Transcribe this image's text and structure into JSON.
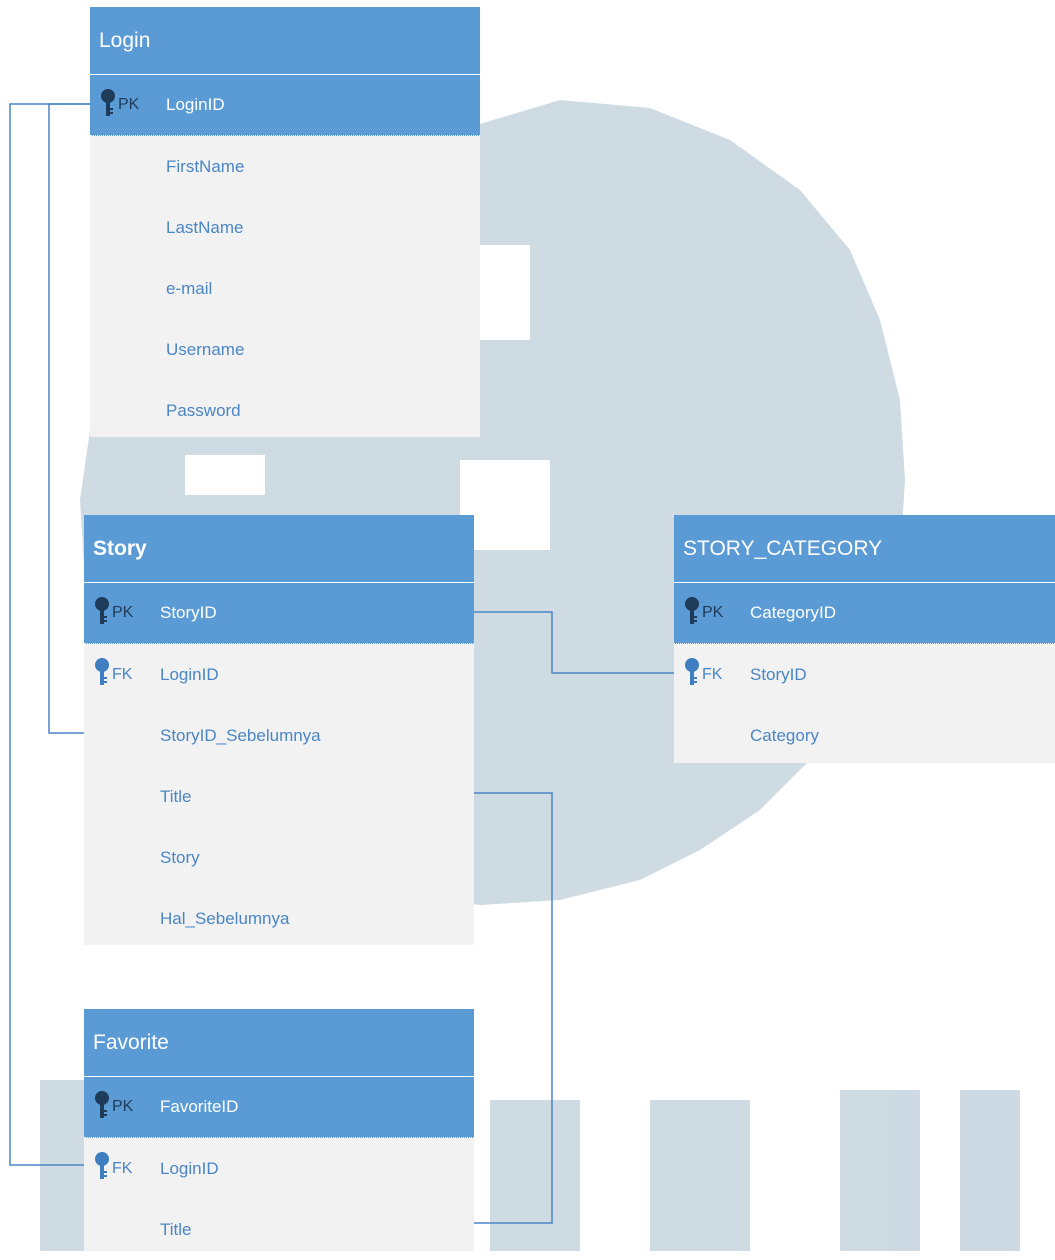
{
  "colors": {
    "header_bg": "#5b9bd5",
    "row_bg": "#f2f2f2",
    "field_text": "#4a86c5",
    "connector": "#4a86c5",
    "watermark": "#c9d7e0"
  },
  "icons": {
    "key": "key-icon"
  },
  "entities": {
    "login": {
      "title": "Login",
      "fields": [
        {
          "key": "PK",
          "name": "LoginID"
        },
        {
          "key": "",
          "name": "FirstName"
        },
        {
          "key": "",
          "name": "LastName"
        },
        {
          "key": "",
          "name": "e-mail"
        },
        {
          "key": "",
          "name": "Username"
        },
        {
          "key": "",
          "name": "Password"
        }
      ]
    },
    "story": {
      "title": "Story",
      "fields": [
        {
          "key": "PK",
          "name": "StoryID"
        },
        {
          "key": "FK",
          "name": "LoginID"
        },
        {
          "key": "",
          "name": "StoryID_Sebelumnya"
        },
        {
          "key": "",
          "name": "Title"
        },
        {
          "key": "",
          "name": "Story"
        },
        {
          "key": "",
          "name": "Hal_Sebelumnya"
        }
      ]
    },
    "story_category": {
      "title": "STORY_CATEGORY",
      "fields": [
        {
          "key": "PK",
          "name": "CategoryID"
        },
        {
          "key": "FK",
          "name": "StoryID"
        },
        {
          "key": "",
          "name": "Category"
        }
      ]
    },
    "favorite": {
      "title": "Favorite",
      "fields": [
        {
          "key": "PK",
          "name": "FavoriteID"
        },
        {
          "key": "FK",
          "name": "LoginID"
        },
        {
          "key": "",
          "name": "Title"
        }
      ]
    }
  }
}
